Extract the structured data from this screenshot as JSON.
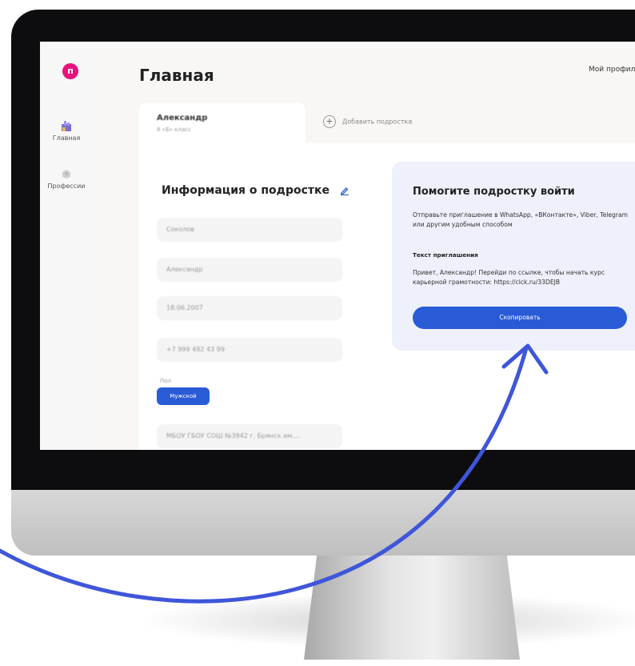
{
  "colors": {
    "accent": "#2a5bd7",
    "logo": "#e6137d",
    "arrow": "#3f56d9",
    "card_bg": "#eef0fb"
  },
  "app": {
    "logo_letter": "п"
  },
  "sidebar": {
    "items": [
      {
        "label": "Главная",
        "icon": "home-icon"
      },
      {
        "label": "Профессии",
        "icon": "professions-icon"
      }
    ]
  },
  "header": {
    "title": "Главная",
    "profile_link": "Мой профиль"
  },
  "tabs": {
    "active_name": "Александр",
    "active_sub": "8 «Б» класс",
    "add_label": "Добавить подростка"
  },
  "info": {
    "title": "Информация о подростке",
    "fields": [
      "Соколов",
      "Александр",
      "18.06.2007",
      "+7 999 492 43 99"
    ],
    "gender_label": "Пол",
    "gender_value": "Мужской",
    "school": "МБОУ ГБОУ СОШ №3842 г. Брянск им...."
  },
  "invite": {
    "title": "Помогите подростку войти",
    "description": "Отправьте приглашение в WhatsApp, «ВКонтакте», Viber, Telegram или другим удобным способом",
    "text_heading": "Текст приглашения",
    "text": "Привет, Александр! Перейди по ссылке, чтобы начать курс карьерной грамотности: https://clck.ru/33DEJB",
    "copy_button": "Скопировать"
  }
}
